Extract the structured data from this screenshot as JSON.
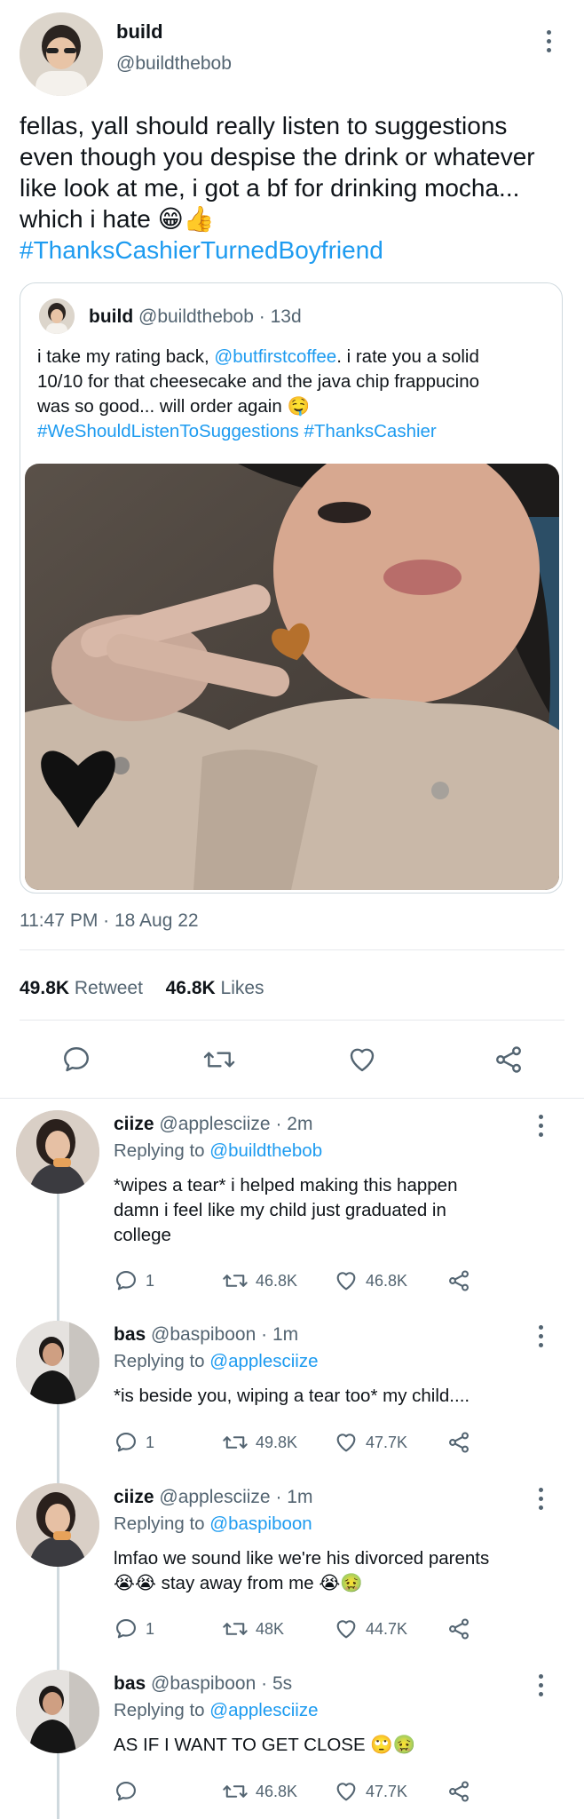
{
  "tweet": {
    "name": "build",
    "handle": "@buildthebob",
    "text_lines": [
      "fellas, yall should really listen to suggestions",
      "even though you despise the drink or whatever",
      "like look at me, i got a bf for drinking mocha...",
      "which i hate 😁👍"
    ],
    "hashtag": "#ThanksCashierTurnedBoyfriend",
    "timestamp": "11:47 PM · 18 Aug 22",
    "retweet_count": "49.8K",
    "retweet_label": "Retweet",
    "like_count": "46.8K",
    "like_label": "Likes"
  },
  "quote": {
    "name": "build",
    "handle": "@buildthebob",
    "age": "· 13d",
    "line1_pre": "i take my rating back, ",
    "line1_mention": "@butfirstcoffee",
    "line1_post": ". i rate you a solid",
    "line2": "10/10 for that cheesecake and the java chip frappucino",
    "line3": "was so good... will order again 🤤",
    "hashtags": "#WeShouldListenToSuggestions #ThanksCashier"
  },
  "actions": {
    "reply_icon": "reply-icon",
    "retweet_icon": "retweet-icon",
    "like_icon": "heart-icon",
    "share_icon": "share-icon"
  },
  "replies": [
    {
      "name": "ciize",
      "handle": "@applesciize",
      "age": "· 2m",
      "replying_label": "Replying to",
      "replying_to": "@buildthebob",
      "text_lines": [
        "*wipes a tear* i helped making this happen",
        "damn i feel like my child just graduated in",
        "college"
      ],
      "reply_count": "1",
      "retweet_count": "46.8K",
      "like_count": "46.8K"
    },
    {
      "name": "bas",
      "handle": "@baspiboon",
      "age": "· 1m",
      "replying_label": "Replying to",
      "replying_to": "@applesciize",
      "text_lines": [
        "*is beside you, wiping a tear too* my child...."
      ],
      "reply_count": "1",
      "retweet_count": "49.8K",
      "like_count": "47.7K"
    },
    {
      "name": "ciize",
      "handle": "@applesciize",
      "age": "· 1m",
      "replying_label": "Replying to",
      "replying_to": "@baspiboon",
      "text_lines": [
        "lmfao we sound like we're his divorced parents",
        "😭😭 stay away from me 😭🤢"
      ],
      "reply_count": "1",
      "retweet_count": "48K",
      "like_count": "44.7K"
    },
    {
      "name": "bas",
      "handle": "@baspiboon",
      "age": "· 5s",
      "replying_label": "Replying to",
      "replying_to": "@applesciize",
      "text_lines": [
        "AS IF I WANT TO GET CLOSE 🙄🤢"
      ],
      "reply_count": "",
      "retweet_count": "46.8K",
      "like_count": "47.7K"
    }
  ],
  "colors": {
    "link": "#1d9bf0",
    "muted": "#536471",
    "divider": "#e6e9ec",
    "heart_emoji": "#b5702c"
  }
}
